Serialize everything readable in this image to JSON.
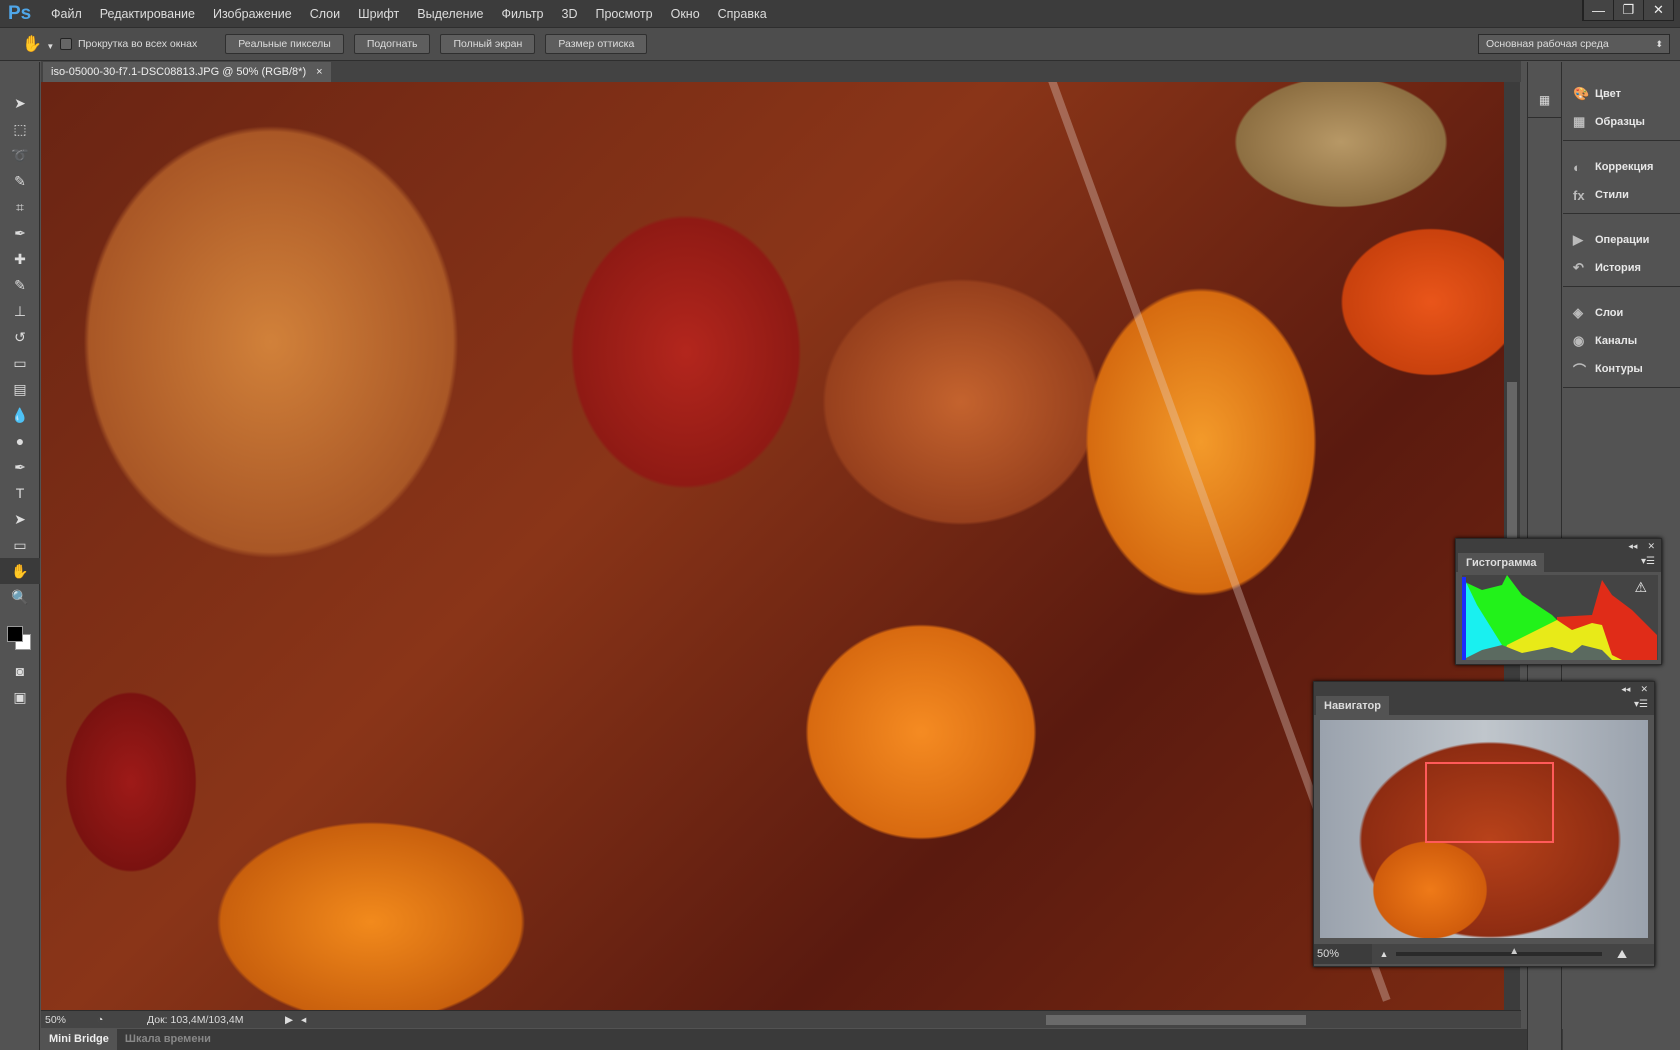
{
  "app": {
    "logo": "Ps",
    "window_controls": [
      "—",
      "❐",
      "✕"
    ]
  },
  "menu": [
    "Файл",
    "Редактирование",
    "Изображение",
    "Слои",
    "Шрифт",
    "Выделение",
    "Фильтр",
    "3D",
    "Просмотр",
    "Окно",
    "Справка"
  ],
  "options": {
    "scroll_all_label": "Прокрутка во всех окнах",
    "scroll_all_checked": false,
    "buttons": [
      "Реальные пикселы",
      "Подогнать",
      "Полный экран",
      "Размер оттиска"
    ],
    "workspace": "Основная рабочая среда"
  },
  "document": {
    "tab_title": "iso-05000-30-f7.1-DSC08813.JPG @ 50% (RGB/8*)",
    "close": "×",
    "zoom": "50%",
    "doc_info": "Док: 103,4M/103,4M"
  },
  "tools": [
    "move",
    "marquee",
    "lasso",
    "quick-select",
    "crop",
    "eyedropper",
    "healing",
    "brush",
    "stamp",
    "history-brush",
    "eraser",
    "gradient",
    "blur",
    "dodge",
    "pen",
    "type",
    "path-select",
    "shape",
    "hand",
    "zoom"
  ],
  "panels": {
    "groups": [
      [
        "Цвет",
        "Образцы"
      ],
      [
        "Коррекция",
        "Стили"
      ],
      [
        "Операции",
        "История"
      ],
      [
        "Слои",
        "Каналы",
        "Контуры"
      ]
    ]
  },
  "histogram": {
    "title": "Гистограмма",
    "warning": "⚠"
  },
  "navigator": {
    "title": "Навигатор",
    "zoom": "50%",
    "zoom_slider": 0.55
  },
  "bottom_tabs": [
    "Mini Bridge",
    "Шкала времени"
  ]
}
